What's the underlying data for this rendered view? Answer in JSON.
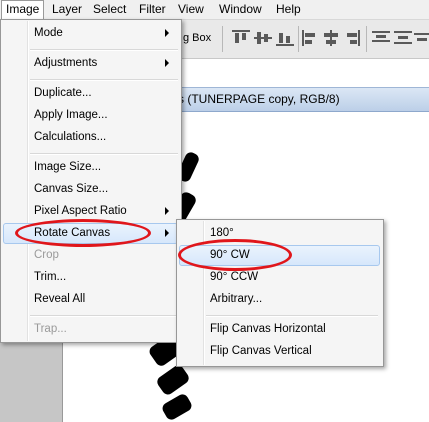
{
  "menubar": {
    "items": [
      "Image",
      "Layer",
      "Select",
      "Filter",
      "View",
      "Window",
      "Help"
    ],
    "active": "Image"
  },
  "toolbar": {
    "bounding_box_label": "g Box"
  },
  "document": {
    "title": "s (TUNERPAGE copy, RGB/8)"
  },
  "image_menu": {
    "items": [
      {
        "label": "Mode",
        "submenu": true
      },
      {
        "label": "Adjustments",
        "submenu": true
      },
      {
        "label": "Duplicate..."
      },
      {
        "label": "Apply Image..."
      },
      {
        "label": "Calculations..."
      },
      {
        "label": "Image Size..."
      },
      {
        "label": "Canvas Size..."
      },
      {
        "label": "Pixel Aspect Ratio",
        "submenu": true
      },
      {
        "label": "Rotate Canvas",
        "submenu": true,
        "highlighted": true
      },
      {
        "label": "Crop",
        "disabled": true
      },
      {
        "label": "Trim..."
      },
      {
        "label": "Reveal All"
      },
      {
        "label": "Trap...",
        "disabled": true
      }
    ]
  },
  "rotate_submenu": {
    "items": [
      {
        "label": "180°"
      },
      {
        "label": "90° CW",
        "highlighted": true
      },
      {
        "label": "90° CCW"
      },
      {
        "label": "Arbitrary..."
      },
      {
        "label": "Flip Canvas Horizontal"
      },
      {
        "label": "Flip Canvas Vertical"
      }
    ]
  },
  "annotation_color": "#e0161b",
  "highlight_color": "#d6e7fb"
}
